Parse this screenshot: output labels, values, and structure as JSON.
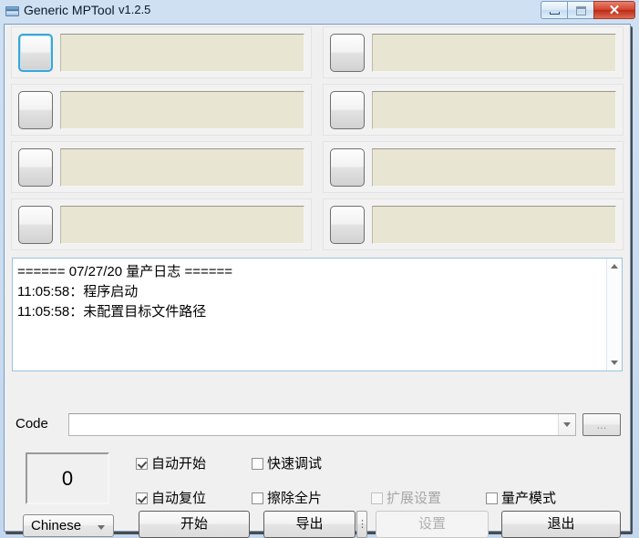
{
  "window": {
    "icon": "app-icon",
    "title": "Generic MPTool",
    "version": "v1.2.5",
    "minimize_label": "",
    "maximize_label": "",
    "close_label": "✕"
  },
  "slots": [
    {
      "id": 1,
      "button_label": "",
      "status_text": "",
      "selected": true
    },
    {
      "id": 2,
      "button_label": "",
      "status_text": "",
      "selected": false
    },
    {
      "id": 3,
      "button_label": "",
      "status_text": "",
      "selected": false
    },
    {
      "id": 4,
      "button_label": "",
      "status_text": "",
      "selected": false
    },
    {
      "id": 5,
      "button_label": "",
      "status_text": "",
      "selected": false
    },
    {
      "id": 6,
      "button_label": "",
      "status_text": "",
      "selected": false
    },
    {
      "id": 7,
      "button_label": "",
      "status_text": "",
      "selected": false
    },
    {
      "id": 8,
      "button_label": "",
      "status_text": "",
      "selected": false
    }
  ],
  "log": {
    "lines": [
      "====== 07/27/20 量产日志 ======",
      "11:05:58：程序启动",
      "11:05:58：未配置目标文件路径"
    ],
    "text": "====== 07/27/20 量产日志 ======\n11:05:58：程序启动\n11:05:58：未配置目标文件路径",
    "scroll_up_icon": "triangle-up-icon",
    "scroll_down_icon": "triangle-down-icon"
  },
  "code_row": {
    "label": "Code",
    "value": "",
    "placeholder": "",
    "dropdown_icon": "chevron-down-icon",
    "browse_label": "..."
  },
  "counter": {
    "value": "0"
  },
  "language": {
    "value": "Chinese",
    "dropdown_icon": "chevron-down-icon"
  },
  "options": [
    {
      "name": "auto-start",
      "label": "自动开始",
      "checked": true,
      "disabled": false
    },
    {
      "name": "quick-debug",
      "label": "快速调试",
      "checked": false,
      "disabled": false
    },
    {
      "name": "auto-reset",
      "label": "自动复位",
      "checked": true,
      "disabled": false
    },
    {
      "name": "erase-all",
      "label": "擦除全片",
      "checked": false,
      "disabled": false
    },
    {
      "name": "extended-settings",
      "label": "扩展设置",
      "checked": false,
      "disabled": true
    },
    {
      "name": "production-mode",
      "label": "量产模式",
      "checked": false,
      "disabled": false
    }
  ],
  "buttons": {
    "start": "开始",
    "export": "导出",
    "export_more": "⋮",
    "settings": "设置",
    "exit": "退出"
  },
  "colors": {
    "accent_selected": "#3aa5d8",
    "field_beige": "#e9e5d3",
    "window_chrome": "#cfe0f2",
    "close_button": "#d2452f"
  }
}
